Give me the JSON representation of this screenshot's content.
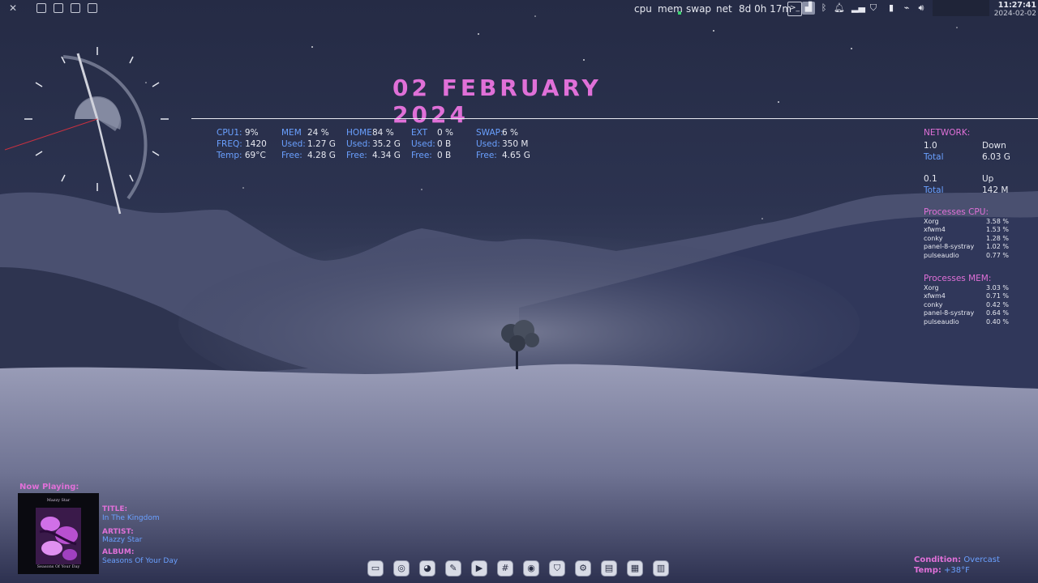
{
  "top_panel": {
    "monitors": [
      {
        "label": "cpu"
      },
      {
        "label": "mem"
      },
      {
        "label": "swap"
      },
      {
        "label": "net"
      }
    ],
    "uptime": "8d 0h 17m",
    "clock": {
      "time": "11:27:41",
      "date": "2024-02-02"
    }
  },
  "date_display": "02 FEBRUARY 2024",
  "stats": {
    "cpu": {
      "label": "CPU1:",
      "value": "9%",
      "freq_label": "FREQ:",
      "freq": "1420",
      "temp_label": "Temp:",
      "temp": "69°C"
    },
    "mem": {
      "label": "MEM",
      "value": "24 %",
      "used_label": "Used:",
      "used": "1.27 G",
      "free_label": "Free:",
      "free": "4.28 G"
    },
    "home": {
      "label": "HOME",
      "value": "84 %",
      "used_label": "Used:",
      "used": "35.2 G",
      "free_label": "Free:",
      "free": "4.34 G"
    },
    "ext": {
      "label": "EXT",
      "value": "0 %",
      "used_label": "Used:",
      "used": "0 B",
      "free_label": "Free:",
      "free": "0 B"
    },
    "swap": {
      "label": "SWAP:",
      "value": "6 %",
      "used_label": "Used:",
      "used": "350 M",
      "free_label": "Free:",
      "free": "4.65 G"
    }
  },
  "network": {
    "title": "NETWORK:",
    "down": {
      "rate": "1.0",
      "label": "Down",
      "total_label": "Total",
      "total": "6.03 G"
    },
    "up": {
      "rate": "0.1",
      "label": "Up",
      "total_label": "Total",
      "total": "142 M"
    }
  },
  "processes_cpu": {
    "title": "Processes CPU:",
    "rows": [
      {
        "name": "Xorg",
        "value": "3.58 %"
      },
      {
        "name": "xfwm4",
        "value": "1.53 %"
      },
      {
        "name": "conky",
        "value": "1.28 %"
      },
      {
        "name": "panel-8-systray",
        "value": "1.02 %"
      },
      {
        "name": "pulseaudio",
        "value": "0.77 %"
      }
    ]
  },
  "processes_mem": {
    "title": "Processes MEM:",
    "rows": [
      {
        "name": "Xorg",
        "value": "3.03 %"
      },
      {
        "name": "xfwm4",
        "value": "0.71 %"
      },
      {
        "name": "conky",
        "value": "0.42 %"
      },
      {
        "name": "panel-8-systray",
        "value": "0.64 %"
      },
      {
        "name": "pulseaudio",
        "value": "0.40 %"
      }
    ]
  },
  "now_playing": {
    "heading": "Now Playing:",
    "album_art_text": {
      "top": "Mazzy Star",
      "bottom": "Seasons Of Your Day"
    },
    "title_label": "TITLE:",
    "title": "In The Kingdom",
    "artist_label": "ARTIST:",
    "artist": "Mazzy Star",
    "album_label": "ALBUM:",
    "album": "Seasons Of Your Day"
  },
  "weather": {
    "condition_label": "Condition:",
    "condition": "Overcast",
    "temp_label": "Temp:",
    "temp": "+38°F"
  },
  "dock": {
    "items": [
      {
        "icon": "window-icon"
      },
      {
        "icon": "browser-icon"
      },
      {
        "icon": "firefox-icon"
      },
      {
        "icon": "text-editor-icon"
      },
      {
        "icon": "video-icon"
      },
      {
        "icon": "slack-icon"
      },
      {
        "icon": "gimp-icon"
      },
      {
        "icon": "shield-icon"
      },
      {
        "icon": "settings-icon"
      },
      {
        "icon": "terminal-icon"
      },
      {
        "icon": "file-manager-icon"
      },
      {
        "icon": "trash-icon"
      }
    ]
  },
  "colors": {
    "accent_pink": "#e070d8",
    "label_blue": "#6aa0ff"
  }
}
